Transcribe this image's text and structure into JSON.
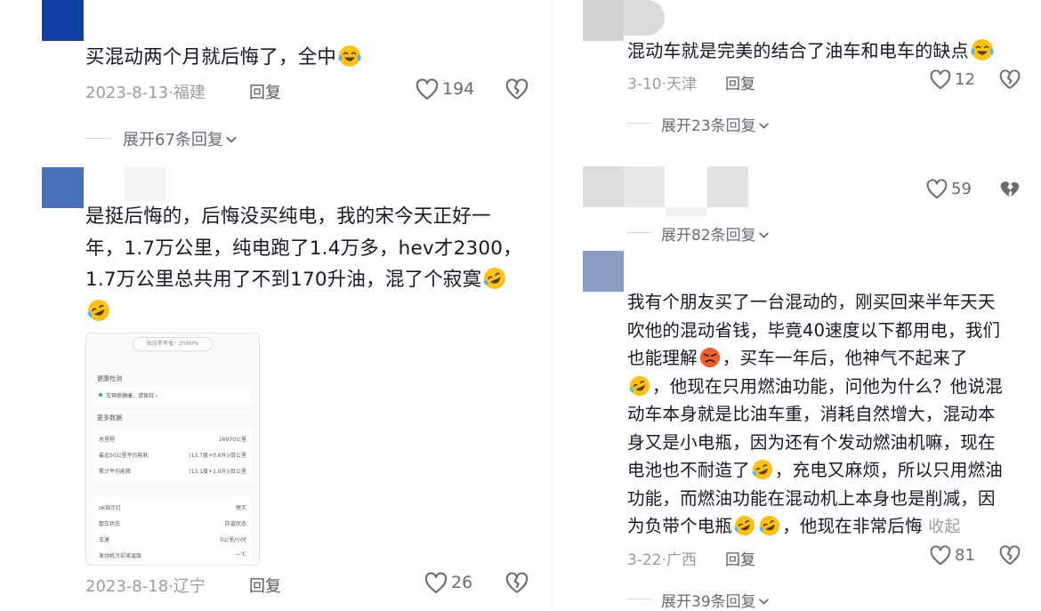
{
  "comments": [
    {
      "id": "c1",
      "text_lines": [
        "买混动两个月就后悔了，全中"
      ],
      "date": "2023-8-13",
      "location": "福建",
      "reply_label": "回复",
      "likes": "194",
      "expand_label": "展开67条回复"
    },
    {
      "id": "c2",
      "text_lines": [
        "是挺后悔的，后悔没买纯电，我的宋今天正好一",
        "年，1.7万公里，纯电跑了1.4万多，hev才2300，",
        "1.7万公里总共用了不到170升油，混了个寂寞"
      ],
      "date": "2023-8-18",
      "location": "辽宁",
      "reply_label": "回复",
      "likes": "26"
    },
    {
      "id": "c3",
      "text_lines": [
        "混动车就是完美的结合了油车和电车的缺点"
      ],
      "date": "3-10",
      "location": "天津",
      "reply_label": "回复",
      "likes": "12",
      "expand_label": "展开23条回复"
    },
    {
      "id": "c4",
      "likes": "59",
      "expand_label": "展开82条回复"
    },
    {
      "id": "c5",
      "text_lines": [
        "我有个朋友买了一台混动的，刚买回来半年天天",
        "吹他的混动省钱，毕竟40速度以下都用电，我们",
        "也能理解",
        "，买车一年后，他神气不起来了",
        "，他现在只用燃油功能，问他为什么？他说混",
        "动车本身就是比油车重，消耗自然增大，混动本",
        "身又是小电瓶，因为还有个发动燃油机嘛，现在",
        "电池也不耐造了",
        "，充电又麻烦，所以只用燃油",
        "功能，而燃油功能在混动机上本身也是削减，因",
        "为负带个电瓶",
        "，他现在非常后悔"
      ],
      "collapse_label": "收起",
      "date": "3-22",
      "location": "广西",
      "reply_label": "回复",
      "likes": "81",
      "expand_label": "展开39条回复"
    }
  ],
  "screenshot": {
    "tire_pressure_ref": "胎压参考值：250kPa",
    "health_title": "健康检测",
    "health_status": "车辆很健康，请保持~",
    "more_title": "更多数据",
    "stats": [
      {
        "label": "总里程",
        "value": "16970公里"
      },
      {
        "label": "最近50公里平均能耗",
        "value": "(13.7度+0.6升)/百公里"
      },
      {
        "label": "累计平均能耗",
        "value": "(13.1度+1.0升)/百公里"
      }
    ],
    "status": [
      {
        "label": "ok指示灯",
        "value": "熄灭"
      },
      {
        "label": "整车状态",
        "value": "防盗状态"
      },
      {
        "label": "车速",
        "value": "0公里/小时"
      },
      {
        "label": "发动机冷却液温度",
        "value": "—℃"
      }
    ]
  },
  "colors": {
    "text": "#161823",
    "meta": "#9b9ba1",
    "icon": "#6b6b73",
    "avatar_blue": "#123fa3",
    "avatar_steel": "#4a70b8"
  },
  "icons": [
    "heart-icon",
    "broken-heart-icon",
    "chevron-down-icon",
    "laugh-cry-emoji",
    "rofl-emoji",
    "angry-emoji"
  ]
}
